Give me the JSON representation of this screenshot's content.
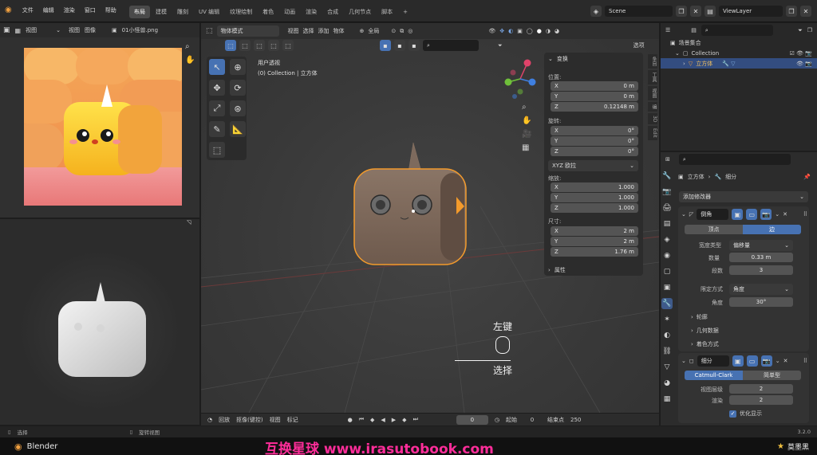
{
  "top_menu": {
    "items": [
      "文件",
      "编辑",
      "渲染",
      "窗口",
      "帮助"
    ]
  },
  "workspace_tabs": [
    "布局",
    "建模",
    "雕刻",
    "UV 编辑",
    "纹理绘制",
    "着色",
    "动画",
    "渲染",
    "合成",
    "几何节点",
    "脚本"
  ],
  "workspace_active": "布局",
  "scene": {
    "label": "Scene",
    "view_layer": "ViewLayer"
  },
  "image_editor": {
    "view_label": "视图",
    "menu_view": "视图",
    "menu_image": "图像",
    "filename": "01小怪兽.png"
  },
  "viewport": {
    "mode": "物体模式",
    "menus": [
      "视图",
      "选择",
      "添加",
      "物体"
    ],
    "orientation": "全局",
    "options_label": "选项",
    "info_line1": "用户透视",
    "info_line2": "(0) Collection | 立方体",
    "hint_left_key": "左键",
    "hint_action": "选择"
  },
  "n_panel": {
    "title": "变换",
    "location_label": "位置:",
    "location": [
      {
        "axis": "X",
        "value": "0 m"
      },
      {
        "axis": "Y",
        "value": "0 m"
      },
      {
        "axis": "Z",
        "value": "0.12148 m"
      }
    ],
    "rotation_label": "旋转:",
    "rotation": [
      {
        "axis": "X",
        "value": "0°"
      },
      {
        "axis": "Y",
        "value": "0°"
      },
      {
        "axis": "Z",
        "value": "0°"
      }
    ],
    "rotation_mode": "XYZ 欧拉",
    "scale_label": "缩放:",
    "scale": [
      {
        "axis": "X",
        "value": "1.000"
      },
      {
        "axis": "Y",
        "value": "1.000"
      },
      {
        "axis": "Z",
        "value": "1.000"
      }
    ],
    "dimensions_label": "尺寸:",
    "dimensions": [
      {
        "axis": "X",
        "value": "2 m"
      },
      {
        "axis": "Y",
        "value": "2 m"
      },
      {
        "axis": "Z",
        "value": "1.76 m"
      }
    ],
    "properties_label": "属性",
    "tabs": [
      "条目",
      "工具",
      "视图",
      "编",
      "3D",
      "Edit"
    ]
  },
  "outliner": {
    "title": "场景集合",
    "collection": "Collection",
    "object": "立方体"
  },
  "properties": {
    "breadcrumb_obj": "立方体",
    "breadcrumb_mod": "细分",
    "add_modifier": "添加修改器",
    "bevel": {
      "name": "倒角",
      "tab_vertex": "顶点",
      "tab_edge": "边",
      "width_type_label": "宽度类型",
      "width_type": "偏移量",
      "amount_label": "数量",
      "amount": "0.33 m",
      "segments_label": "段数",
      "segments": "3",
      "limit_label": "限定方式",
      "limit": "角度",
      "angle_label": "角度",
      "angle": "30°",
      "sections": [
        "轮廓",
        "几何数据",
        "着色方式"
      ]
    },
    "subsurf": {
      "name": "细分",
      "tab_cc": "Catmull-Clark",
      "tab_simple": "简单型",
      "viewport_label": "视图层级",
      "viewport": "2",
      "render_label": "渲染",
      "render": "2",
      "optimal_label": "优化显示"
    }
  },
  "timeline": {
    "menus": [
      "回放",
      "抠像(键控)",
      "视图",
      "标记"
    ],
    "current_frame": "0",
    "start_label": "起始",
    "start": "0",
    "end_label": "结束点",
    "end": "250"
  },
  "statusbar": {
    "left": "选择",
    "mid": "旋转视图",
    "version": "3.2.0"
  },
  "footer": {
    "app_name": "Blender",
    "watermark": "互换星球 www.irasutobook.com",
    "brand": "莫墨黑"
  },
  "colors": {
    "accent": "#4772b3",
    "watermark": "#ff2d9a",
    "bg": "#1d1d1d"
  }
}
